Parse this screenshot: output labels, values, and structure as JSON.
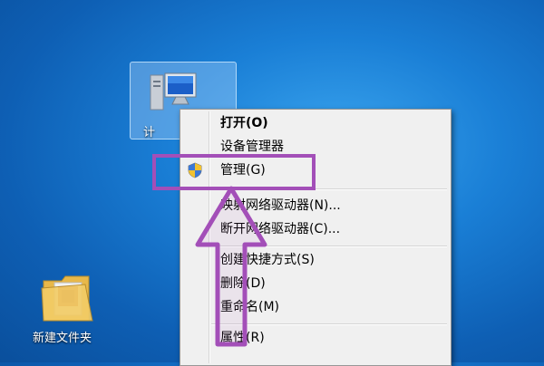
{
  "desktop": {
    "computer_icon_label": "计",
    "folder_icon_label": "新建文件夹"
  },
  "context_menu": {
    "items": [
      {
        "label": "打开(O)"
      },
      {
        "label": "设备管理器"
      },
      {
        "label": "管理(G)"
      },
      {
        "label": "映射网络驱动器(N)..."
      },
      {
        "label": "断开网络驱动器(C)..."
      },
      {
        "label": "创建快捷方式(S)"
      },
      {
        "label": "删除(D)"
      },
      {
        "label": "重命名(M)"
      },
      {
        "label": "属性(R)"
      }
    ]
  },
  "annotation": {
    "color": "#a34fb8",
    "shape": "arrow-up"
  },
  "colors": {
    "desktop_background": "#1a7fd6",
    "menu_background": "#f0f0f0"
  }
}
